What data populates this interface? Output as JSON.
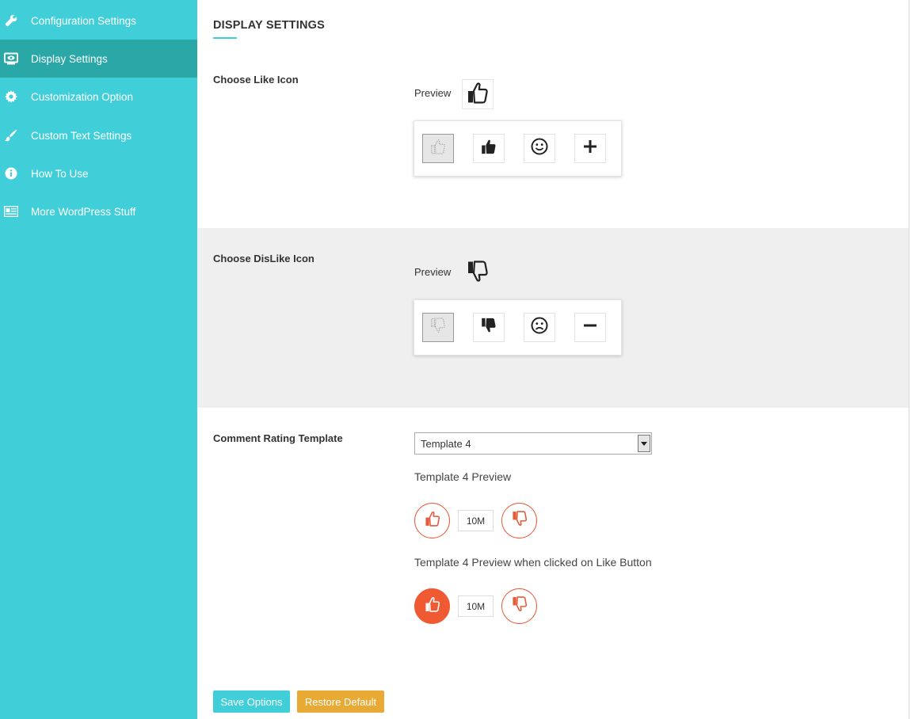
{
  "sidebar": {
    "items": [
      {
        "label": "Configuration Settings",
        "icon": "wrench-icon",
        "active": false
      },
      {
        "label": "Display Settings",
        "icon": "monitor-eye-icon",
        "active": true
      },
      {
        "label": "Customization Option",
        "icon": "gear-icon",
        "active": false
      },
      {
        "label": "Custom Text Settings",
        "icon": "brush-icon",
        "active": false
      },
      {
        "label": "How To Use",
        "icon": "info-icon",
        "active": false
      },
      {
        "label": "More WordPress Stuff",
        "icon": "newspaper-icon",
        "active": false
      }
    ]
  },
  "main": {
    "title": "DISPLAY SETTINGS",
    "like_section": {
      "label": "Choose Like Icon",
      "preview_label": "Preview",
      "options": [
        "thumbs-up-outline-icon",
        "thumbs-up-solid-icon",
        "smile-icon",
        "plus-icon"
      ],
      "selected_index": 0
    },
    "dislike_section": {
      "label": "Choose DisLike Icon",
      "preview_label": "Preview",
      "options": [
        "thumbs-down-outline-icon",
        "thumbs-down-solid-icon",
        "frown-icon",
        "minus-icon"
      ],
      "selected_index": 0
    },
    "template_section": {
      "label": "Comment Rating Template",
      "selected_template": "Template 4",
      "preview_title": "Template 4 Preview",
      "clicked_preview_title": "Template 4 Preview when clicked on Like Button",
      "count": "10M"
    },
    "buttons": {
      "save": "Save Options",
      "restore": "Restore Default"
    }
  },
  "colors": {
    "sidebar_bg": "#40ced9",
    "sidebar_active": "#2aa7a7",
    "accent_orange": "#ef5a33",
    "save_button": "#40ced9",
    "restore_button": "#e8a935"
  }
}
